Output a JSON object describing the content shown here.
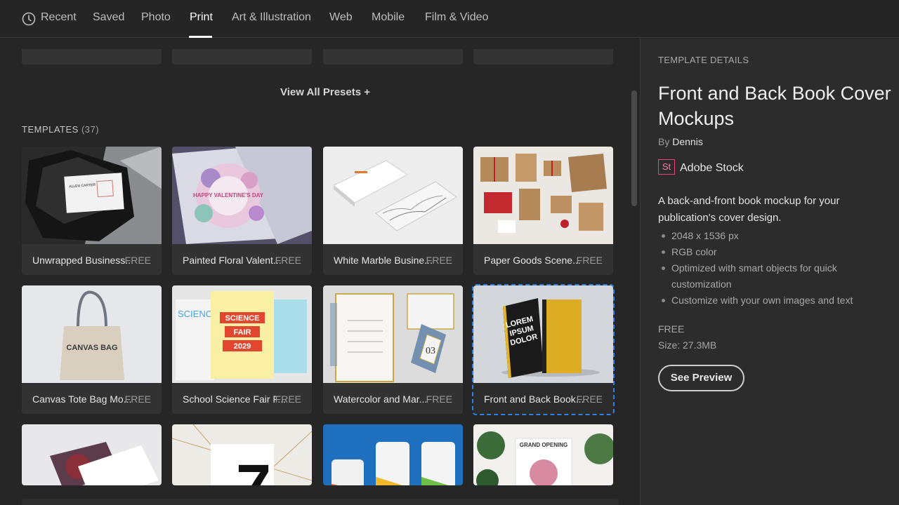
{
  "nav": {
    "tabs": [
      {
        "label": "Recent"
      },
      {
        "label": "Saved"
      },
      {
        "label": "Photo"
      },
      {
        "label": "Print"
      },
      {
        "label": "Art & Illustration"
      },
      {
        "label": "Web"
      },
      {
        "label": "Mobile"
      },
      {
        "label": "Film & Video"
      }
    ],
    "active_tab": "Print"
  },
  "presets": {
    "view_all_label": "View All Presets +"
  },
  "templates": {
    "heading": "TEMPLATES",
    "count": "(37)",
    "items": [
      {
        "title": "Unwrapped Business...",
        "price": "FREE"
      },
      {
        "title": "Painted Floral Valent...",
        "price": "FREE"
      },
      {
        "title": "White Marble Busine...",
        "price": "FREE"
      },
      {
        "title": "Paper Goods Scene...",
        "price": "FREE"
      },
      {
        "title": "Canvas Tote Bag Mo...",
        "price": "FREE"
      },
      {
        "title": "School Science Fair F...",
        "price": "FREE"
      },
      {
        "title": "Watercolor and Mar...",
        "price": "FREE"
      },
      {
        "title": "Front and Back Book...",
        "price": "FREE"
      }
    ],
    "selected_index": 7,
    "thumb_text": {
      "allen_carter": "ALLEN CARTER",
      "happy_valentines": "HAPPY VALENTINE'S DAY",
      "canvas_bag": "CANVAS BAG",
      "science": "SCIENCE",
      "fair": "FAIR",
      "year": "2029",
      "lorem": "LOREM",
      "ipsum": "IPSUM",
      "dolor": "DOLOR",
      "seven": "7",
      "grand_opening": "GRAND OPENING",
      "card_03": "03"
    }
  },
  "details": {
    "section_label": "TEMPLATE DETAILS",
    "title": "Front and Back Book Cover Mockups",
    "by_prefix": "By",
    "author": "Dennis",
    "stock_badge": "St",
    "stock_name": "Adobe Stock",
    "description": "A back-and-front book mockup for your publication's cover design.",
    "features": [
      "2048 x 1536 px",
      "RGB color",
      "Optimized with smart objects for quick customization",
      "Customize with your own images and text"
    ],
    "price": "FREE",
    "size_label": "Size:",
    "size_value": "27.3MB",
    "preview_button": "See Preview"
  },
  "colors": {
    "background": "#212121",
    "panel": "#2c2c2c",
    "selection": "#2f80e3",
    "stock_accent": "#e8457b"
  }
}
